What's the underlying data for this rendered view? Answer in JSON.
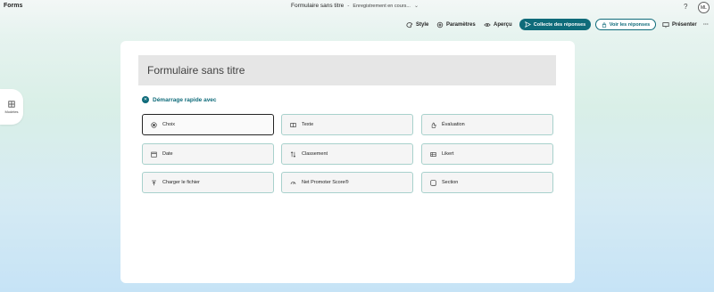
{
  "app": {
    "name": "Forms"
  },
  "document": {
    "title": "Formulaire sans titre",
    "separator": "-",
    "status": "Enregistrement en cours..."
  },
  "header": {
    "help": "?",
    "avatar_initials": "ML"
  },
  "toolbar": {
    "style": "Style",
    "settings": "Paramètres",
    "preview": "Aperçu",
    "collect": "Collecte des réponses",
    "view_responses": "Voir les réponses",
    "present": "Présenter",
    "more": "···"
  },
  "sidebar": {
    "templates_label": "Modèles"
  },
  "form": {
    "title": "Formulaire sans titre",
    "quick_start_label": "Démarrage rapide avec",
    "options": [
      {
        "label": "Choix",
        "icon": "radio-icon"
      },
      {
        "label": "Texte",
        "icon": "text-icon"
      },
      {
        "label": "Évaluation",
        "icon": "rating-icon"
      },
      {
        "label": "Date",
        "icon": "calendar-icon"
      },
      {
        "label": "Classement",
        "icon": "ranking-icon"
      },
      {
        "label": "Likert",
        "icon": "likert-icon"
      },
      {
        "label": "Charger le fichier",
        "icon": "upload-icon"
      },
      {
        "label": "Net Promoter Score®",
        "icon": "nps-icon"
      },
      {
        "label": "Section",
        "icon": "section-icon"
      }
    ]
  },
  "colors": {
    "accent": "#0f6b7a",
    "option_border": "#a8d1cc"
  }
}
